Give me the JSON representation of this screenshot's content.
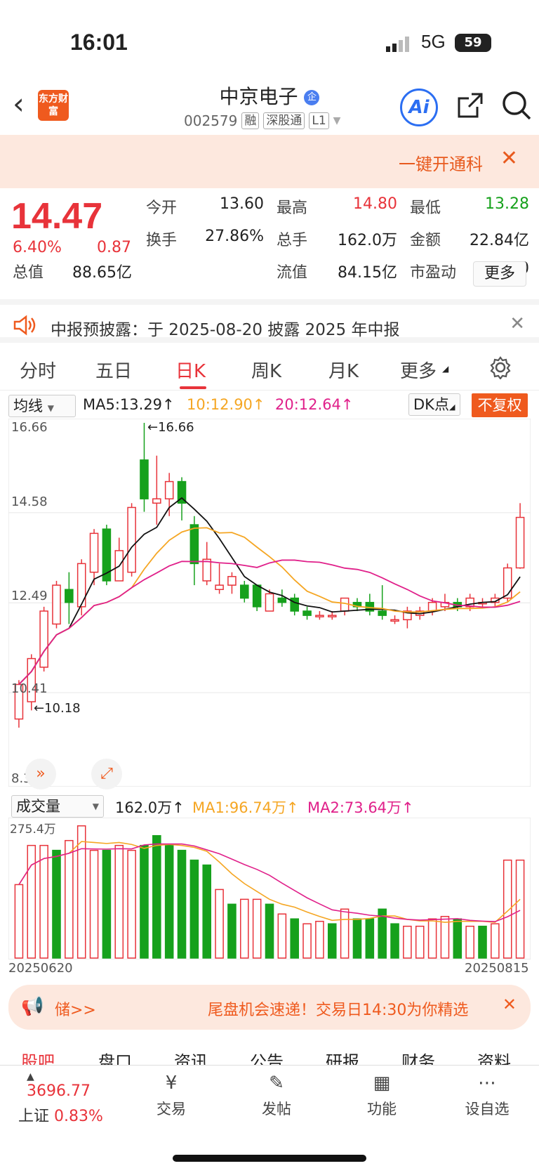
{
  "status": {
    "time": "16:01",
    "network": "5G",
    "battery": "59"
  },
  "header": {
    "logo": "东方财富",
    "title": "中京电子",
    "code": "002579",
    "tags": [
      "融",
      "深股通",
      "L1"
    ]
  },
  "promo": {
    "text": "一键开通科",
    "close": "✕"
  },
  "quote": {
    "price": "14.47",
    "pct": "6.40%",
    "change": "0.87",
    "fields": [
      {
        "label": "今开",
        "value": "13.60",
        "color": "#222"
      },
      {
        "label": "最高",
        "value": "14.80",
        "color": "#e8333a"
      },
      {
        "label": "最低",
        "value": "13.28",
        "color": "#16a11c"
      },
      {
        "label": "换手",
        "value": "27.86%",
        "color": "#222"
      },
      {
        "label": "总手",
        "value": "162.0万",
        "color": "#222"
      },
      {
        "label": "金额",
        "value": "22.84亿",
        "color": "#222"
      },
      {
        "label": "总值",
        "value": "88.65亿",
        "color": "#222"
      },
      {
        "label": "流值",
        "value": "84.15亿",
        "color": "#222"
      },
      {
        "label": "市盈动",
        "value": "327.80",
        "color": "#222"
      }
    ],
    "more": "更多"
  },
  "notice": {
    "text": "中报预披露：于 2025-08-20 披露 2025 年中报"
  },
  "tabs": [
    "分时",
    "五日",
    "日K",
    "周K",
    "月K",
    "更多"
  ],
  "active_tab": "日K",
  "ma": {
    "selector": "均线",
    "ma5": "MA5:13.29↑",
    "ma10": "10:12.90↑",
    "ma20": "20:12.64↑",
    "dk": "DK点",
    "fq": "不复权"
  },
  "price_axis": {
    "top": "16.66",
    "mid1": "14.58",
    "mid2": "12.49",
    "low": "10.41",
    "bottom": "8.33",
    "max_label": "←16.66",
    "min_label": "←10.18"
  },
  "vol": {
    "selector": "成交量",
    "value": "162.0万↑",
    "ma1": "MA1:96.74万↑",
    "ma2": "MA2:73.64万↑",
    "max": "275.4万",
    "start_date": "20250620",
    "end_date": "20250815"
  },
  "chart_data": {
    "type": "candlestick",
    "candles": [
      [
        9.8,
        10.6,
        9.6,
        10.7
      ],
      [
        10.2,
        11.2,
        10.0,
        11.3
      ],
      [
        11.0,
        12.3,
        10.9,
        12.4
      ],
      [
        12.0,
        12.9,
        11.9,
        13.0
      ],
      [
        12.8,
        12.5,
        12.0,
        13.2
      ],
      [
        12.4,
        13.4,
        12.2,
        13.5
      ],
      [
        13.2,
        14.1,
        12.9,
        14.2
      ],
      [
        14.2,
        13.0,
        12.9,
        14.3
      ],
      [
        13.0,
        13.7,
        13.0,
        14.0
      ],
      [
        13.2,
        14.7,
        13.1,
        14.8
      ],
      [
        15.8,
        14.9,
        14.6,
        16.66
      ],
      [
        14.8,
        14.9,
        14.3,
        15.9
      ],
      [
        14.9,
        15.3,
        14.5,
        15.5
      ],
      [
        15.3,
        14.8,
        14.4,
        15.4
      ],
      [
        14.3,
        13.4,
        12.9,
        14.5
      ],
      [
        13.0,
        13.5,
        12.9,
        13.9
      ],
      [
        12.8,
        12.9,
        12.7,
        13.4
      ],
      [
        12.9,
        13.1,
        12.7,
        13.2
      ],
      [
        12.9,
        12.6,
        12.5,
        13.0
      ],
      [
        12.9,
        12.4,
        12.3,
        12.9
      ],
      [
        12.3,
        12.7,
        12.3,
        12.8
      ],
      [
        12.6,
        12.5,
        12.4,
        12.8
      ],
      [
        12.6,
        12.3,
        12.2,
        12.7
      ],
      [
        12.3,
        12.2,
        12.1,
        12.4
      ],
      [
        12.2,
        12.2,
        12.1,
        12.3
      ],
      [
        12.2,
        12.2,
        12.1,
        12.3
      ],
      [
        12.3,
        12.6,
        12.2,
        12.6
      ],
      [
        12.5,
        12.4,
        12.3,
        12.6
      ],
      [
        12.5,
        12.3,
        12.2,
        12.7
      ],
      [
        12.3,
        12.2,
        12.1,
        12.9
      ],
      [
        12.1,
        12.1,
        12.0,
        12.2
      ],
      [
        12.1,
        12.3,
        11.9,
        12.4
      ],
      [
        12.2,
        12.3,
        12.1,
        12.4
      ],
      [
        12.3,
        12.5,
        12.2,
        12.6
      ],
      [
        12.4,
        12.5,
        12.3,
        12.7
      ],
      [
        12.5,
        12.4,
        12.3,
        12.6
      ],
      [
        12.4,
        12.6,
        12.3,
        12.7
      ],
      [
        12.5,
        12.5,
        12.4,
        12.6
      ],
      [
        12.5,
        12.6,
        12.4,
        12.7
      ],
      [
        12.6,
        13.3,
        12.5,
        13.4
      ],
      [
        13.3,
        14.47,
        13.28,
        14.8
      ]
    ],
    "volume": [
      150,
      230,
      230,
      220,
      240,
      270,
      220,
      220,
      230,
      220,
      230,
      250,
      230,
      220,
      200,
      190,
      140,
      110,
      120,
      120,
      110,
      90,
      80,
      70,
      75,
      70,
      100,
      80,
      80,
      100,
      70,
      65,
      65,
      80,
      85,
      80,
      65,
      65,
      70,
      200,
      200
    ],
    "vol_up": [
      1,
      1,
      1,
      0,
      1,
      1,
      1,
      0,
      1,
      1,
      0,
      0,
      0,
      0,
      0,
      0,
      1,
      0,
      1,
      1,
      0,
      1,
      0,
      1,
      1,
      0,
      1,
      0,
      0,
      0,
      0,
      1,
      1,
      1,
      1,
      0,
      1,
      0,
      1,
      1,
      1
    ],
    "ylim": [
      8.33,
      16.66
    ],
    "vol_max": 275.4
  }
}
